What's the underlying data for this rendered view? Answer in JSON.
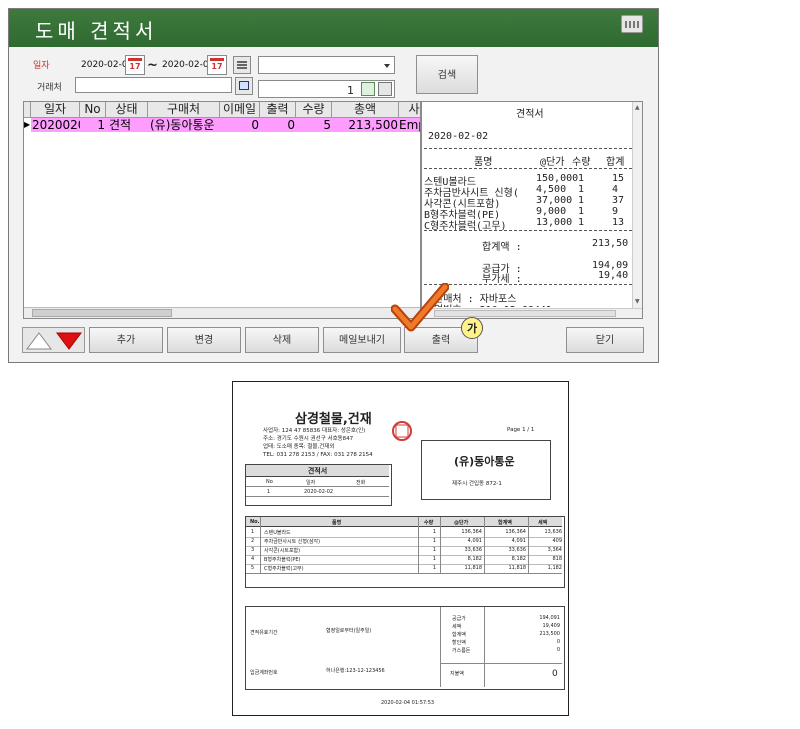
{
  "app": {
    "title": "도매 견적서",
    "icons": {
      "keyboard": "keyboard-icon",
      "calendar": "calendar-icon",
      "search_small": "magnifier-icon",
      "printer": "printer-icon"
    },
    "filters": {
      "date_label": "일자",
      "date_from": "2020-02-02",
      "range_sep": "~",
      "date_to": "2020-02-02",
      "client_label": "거래처",
      "client_value": "",
      "dropdown_value": "",
      "page": "1"
    },
    "search_button": "검색",
    "grid": {
      "columns": [
        "일자",
        "No",
        "상태",
        "구매처",
        "이메일",
        "출력",
        "수량",
        "총액",
        "사"
      ],
      "rows": [
        {
          "date": "2020020",
          "no": "1",
          "status": "견적",
          "buyer": "(유)동아통운",
          "email": "0",
          "print": "0",
          "qty": "5",
          "total": "213,500",
          "staff": "Emp"
        }
      ]
    },
    "preview": {
      "title": "견적서",
      "date": "2020-02-02",
      "header": {
        "name": "품명",
        "price": "@단가",
        "qty": "수량",
        "sum": "합계"
      },
      "items": [
        {
          "name": "스텐U볼라드",
          "price": "150,000",
          "qty": "1",
          "sum": "15"
        },
        {
          "name": "주차금반사시트 신형(",
          "price": "4,500",
          "qty": "1",
          "sum": "4"
        },
        {
          "name": "사각콘(시트포함)",
          "price": "37,000",
          "qty": "1",
          "sum": "37"
        },
        {
          "name": "B형주차블럭(PE)",
          "price": "9,000",
          "qty": "1",
          "sum": "9"
        },
        {
          "name": "C형주차블럭(고무)",
          "price": "13,000",
          "qty": "1",
          "sum": "13"
        }
      ],
      "total_label": "합계액 :",
      "total_value": "213,50",
      "supply_label": "공급가 :",
      "supply_value": "194,09",
      "vat_label": "부가세 :",
      "vat_value": "19,40",
      "seller_label": "판매처 : 자바포스",
      "seller_sub": "업번호 : 210-12-68441"
    },
    "toolbar": {
      "add": "추가",
      "edit": "변경",
      "delete": "삭제",
      "mail": "메일보내기",
      "print": "출력",
      "close": "닫기",
      "badge": "가"
    },
    "colors": {
      "titlebar": "#3a763b",
      "selected_row": "#ff9cff",
      "check": "#e05a10",
      "arrow_down": "#dd1111"
    }
  },
  "receipt": {
    "company": "삼경철물,건재",
    "company_lines": [
      "사업자: 124 47 85836  대표자: 성은호(인)",
      "주소: 경기도 수원시 권선구 서호동847",
      "업태: 도소매  종목: 철물,건재외",
      "TEL: 031 278 2153 / FAX: 031 278 2154"
    ],
    "page": "Page  1  /  1",
    "client_name": "(유)동아통운",
    "client_address": "제주시 건입동 872-1",
    "doc_title": "견적서",
    "info_headers": [
      "No",
      "일자",
      "전화"
    ],
    "info_values": [
      "1",
      "2020-02-02",
      ""
    ],
    "table_headers": [
      "No.",
      "품명",
      "수량",
      "@단가",
      "합계액",
      "세액"
    ],
    "rows": [
      [
        "1",
        "스텐U볼라드",
        "1",
        "136,364",
        "136,364",
        "13,636"
      ],
      [
        "2",
        "주차금반사시트 신형(삼각)",
        "1",
        "4,091",
        "4,091",
        "409"
      ],
      [
        "3",
        "사각콘(시트포함)",
        "1",
        "33,636",
        "33,636",
        "3,364"
      ],
      [
        "4",
        "B형주차블럭(PE)",
        "1",
        "8,182",
        "8,182",
        "818"
      ],
      [
        "5",
        "C형주차블럭(고무)",
        "1",
        "11,818",
        "11,818",
        "1,182"
      ]
    ],
    "footer": {
      "validity_label": "견적유효기간",
      "validity_value": "협정일로부터(일주일)",
      "account_label": "입금계좌번호",
      "account_value": "하나은행:123-12-123456",
      "summary_labels": [
        "공급가",
        "세액",
        "합계액",
        "할인액",
        "거스름돈"
      ],
      "summary_values": [
        "194,091",
        "19,409",
        "213,500",
        "0",
        "0"
      ],
      "due_label": "지불액",
      "due_value": "0"
    },
    "printed_at": "2020-02-04 01:57:53"
  }
}
